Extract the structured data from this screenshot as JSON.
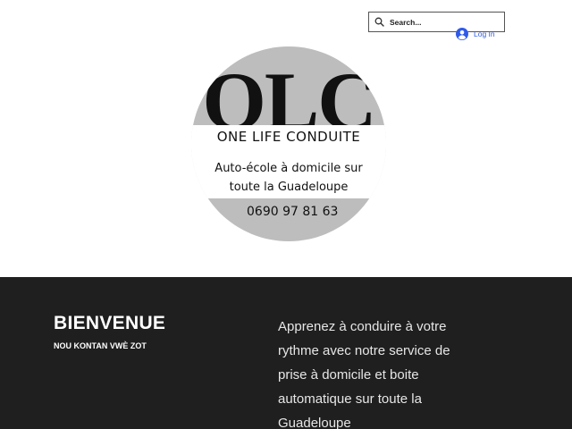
{
  "header": {
    "search": {
      "placeholder": "Search..."
    },
    "login": {
      "label": "Log In"
    }
  },
  "logo": {
    "letters": "OLC",
    "brand_name": "ONE LIFE CONDUITE",
    "tagline_line1": "Auto-école à domicile sur",
    "tagline_line2": "toute la Guadeloupe",
    "phone": "0690 97 81 63"
  },
  "welcome": {
    "title": "BIENVENUE",
    "subtitle": "NOU KONTAN VWÈ ZOT",
    "text_lines": [
      "Apprenez à conduire à votre",
      "rythme avec notre service de",
      "prise à domicile et boite",
      "automatique sur toute la",
      "Guadeloupe"
    ]
  },
  "colors": {
    "accent_link": "#2f5bea",
    "logo_grey": "#bdbdbd",
    "dark_strip": "#1f1f1f"
  }
}
